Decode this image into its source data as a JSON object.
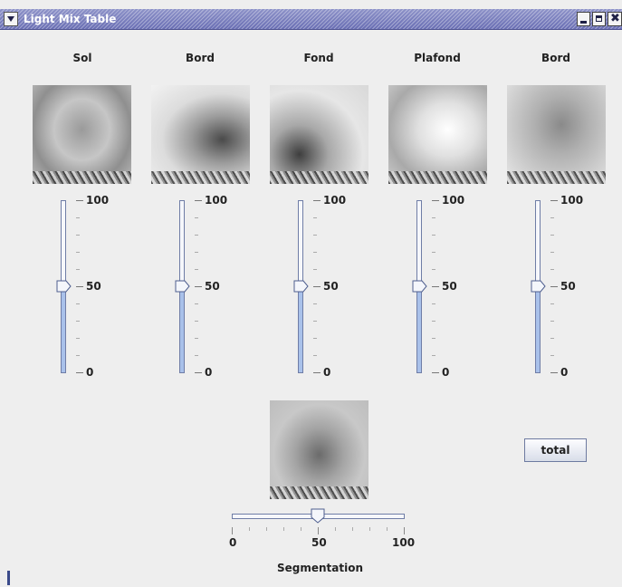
{
  "window": {
    "title": "Light Mix Table"
  },
  "channels": [
    {
      "label": "Sol",
      "value": 50
    },
    {
      "label": "Bord",
      "value": 50
    },
    {
      "label": "Fond",
      "value": 50
    },
    {
      "label": "Plafond",
      "value": 50
    },
    {
      "label": "Bord",
      "value": 50
    }
  ],
  "vslider_labels": {
    "max": "100",
    "mid": "50",
    "min": "0"
  },
  "total_button": {
    "label": "total"
  },
  "segmentation": {
    "label": "Segmentation",
    "value": 50,
    "tick_labels": [
      "0",
      "50",
      "100"
    ]
  },
  "colors": {
    "track_fill": "#a9c1ea",
    "titlebar": "#7a7fbe"
  },
  "icons": {
    "menu": "chevron-down-icon",
    "minimize": "minimize-icon",
    "maximize": "maximize-icon",
    "close": "close-icon"
  }
}
